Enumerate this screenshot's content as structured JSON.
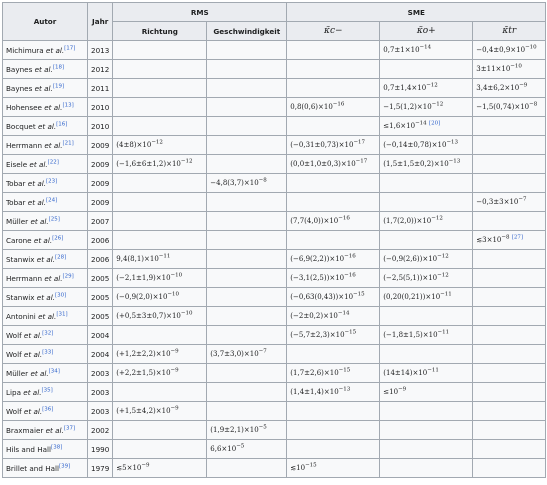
{
  "headers": {
    "autor": "Autor",
    "jahr": "Jahr",
    "rms": "RMS",
    "sme": "SME",
    "richtung": "Richtung",
    "geschwindigkeit": "Geschwindigkeit",
    "kappa_cminus": "κ̃c−",
    "kappa_oplus": "κ̃o+",
    "kappa_tr": "κ̃tr"
  },
  "rows": [
    {
      "author": "Michimura",
      "etal": true,
      "ref": "[17]",
      "year": "2013",
      "richtung": "",
      "geschw": "",
      "c": "",
      "o": "0,7±1×10",
      "o_exp": "−14",
      "o_ref": "",
      "tr": "−0,4±0,9×10",
      "tr_exp": "−10"
    },
    {
      "author": "Baynes",
      "etal": true,
      "ref": "[18]",
      "year": "2012",
      "richtung": "",
      "geschw": "",
      "c": "",
      "o": "",
      "tr": "3±11×10",
      "tr_exp": "−10"
    },
    {
      "author": "Baynes",
      "etal": true,
      "ref": "[19]",
      "year": "2011",
      "richtung": "",
      "geschw": "",
      "c": "",
      "o": "0,7±1,4×10",
      "o_exp": "−12",
      "tr": "3,4±6,2×10",
      "tr_exp": "−9"
    },
    {
      "author": "Hohensee",
      "etal": true,
      "ref": "[13]",
      "year": "2010",
      "richtung": "",
      "geschw": "",
      "c": "0,8(0,6)×10",
      "c_exp": "−16",
      "o": "−1,5(1,2)×10",
      "o_exp": "−12",
      "tr": "−1,5(0,74)×10",
      "tr_exp": "−8"
    },
    {
      "author": "Bocquet",
      "etal": true,
      "ref": "[16]",
      "year": "2010",
      "richtung": "",
      "geschw": "",
      "c": "",
      "o": "≤1,6×10",
      "o_exp": "−14",
      "o_ref": "[20]",
      "tr": ""
    },
    {
      "author": "Herrmann",
      "etal": true,
      "ref": "[21]",
      "year": "2009",
      "richtung": "(4±8)×10",
      "r_exp": "−12",
      "geschw": "",
      "c": "(−0,31±0,73)×10",
      "c_exp": "−17",
      "o": "(−0,14±0,78)×10",
      "o_exp": "−13",
      "tr": ""
    },
    {
      "author": "Eisele",
      "etal": true,
      "ref": "[22]",
      "year": "2009",
      "richtung": "(−1,6±6±1,2)×10",
      "r_exp": "−12",
      "geschw": "",
      "c": "(0,0±1,0±0,3)×10",
      "c_exp": "−17",
      "o": "(1,5±1,5±0,2)×10",
      "o_exp": "−13",
      "tr": ""
    },
    {
      "author": "Tobar",
      "etal": true,
      "ref": "[23]",
      "year": "2009",
      "richtung": "",
      "geschw": "−4,8(3,7)×10",
      "g_exp": "−8",
      "c": "",
      "o": "",
      "tr": ""
    },
    {
      "author": "Tobar",
      "etal": true,
      "ref": "[24]",
      "year": "2009",
      "richtung": "",
      "geschw": "",
      "c": "",
      "o": "",
      "tr": "−0,3±3×10",
      "tr_exp": "−7"
    },
    {
      "author": "Müller",
      "etal": true,
      "ref": "[25]",
      "year": "2007",
      "richtung": "",
      "geschw": "",
      "c": "(7,7(4,0))×10",
      "c_exp": "−16",
      "o": "(1,7(2,0))×10",
      "o_exp": "−12",
      "tr": ""
    },
    {
      "author": "Carone",
      "etal": true,
      "ref": "[26]",
      "year": "2006",
      "richtung": "",
      "geschw": "",
      "c": "",
      "o": "",
      "tr": "≲3×10",
      "tr_exp": "−8",
      "tr_ref": "[27]"
    },
    {
      "author": "Stanwix",
      "etal": true,
      "ref": "[28]",
      "year": "2006",
      "richtung": "9,4(8,1)×10",
      "r_exp": "−11",
      "geschw": "",
      "c": "(−6,9(2,2))×10",
      "c_exp": "−16",
      "o": "(−0,9(2,6))×10",
      "o_exp": "−12",
      "tr": ""
    },
    {
      "author": "Herrmann",
      "etal": true,
      "ref": "[29]",
      "year": "2005",
      "richtung": "(−2,1±1,9)×10",
      "r_exp": "−10",
      "geschw": "",
      "c": "(−3,1(2,5))×10",
      "c_exp": "−16",
      "o": "(−2,5(5,1))×10",
      "o_exp": "−12",
      "tr": ""
    },
    {
      "author": "Stanwix",
      "etal": true,
      "ref": "[30]",
      "year": "2005",
      "richtung": "(−0,9(2,0)×10",
      "r_exp": "−10",
      "geschw": "",
      "c": "(−0,63(0,43))×10",
      "c_exp": "−15",
      "o": "(0,20(0,21))×10",
      "o_exp": "−11",
      "tr": ""
    },
    {
      "author": "Antonini",
      "etal": true,
      "ref": "[31]",
      "year": "2005",
      "richtung": "(+0,5±3±0,7)×10",
      "r_exp": "−10",
      "geschw": "",
      "c": "(−2±0,2)×10",
      "c_exp": "−14",
      "o": "",
      "tr": ""
    },
    {
      "author": "Wolf",
      "etal": true,
      "ref": "[32]",
      "year": "2004",
      "richtung": "",
      "geschw": "",
      "c": "(−5,7±2,3)×10",
      "c_exp": "−15",
      "o": "(−1,8±1,5)×10",
      "o_exp": "−11",
      "tr": ""
    },
    {
      "author": "Wolf",
      "etal": true,
      "ref": "[33]",
      "year": "2004",
      "richtung": "(+1,2±2,2)×10",
      "r_exp": "−9",
      "geschw": "(3,7±3,0)×10",
      "g_exp": "−7",
      "c": "",
      "o": "",
      "tr": ""
    },
    {
      "author": "Müller",
      "etal": true,
      "ref": "[34]",
      "year": "2003",
      "richtung": "(+2,2±1,5)×10",
      "r_exp": "−9",
      "geschw": "",
      "c": "(1,7±2,6)×10",
      "c_exp": "−15",
      "o": "(14±14)×10",
      "o_exp": "−11",
      "tr": ""
    },
    {
      "author": "Lipa",
      "etal": true,
      "ref": "[35]",
      "year": "2003",
      "richtung": "",
      "geschw": "",
      "c": "(1,4±1,4)×10",
      "c_exp": "−13",
      "o": "≤10",
      "o_exp": "−9",
      "tr": ""
    },
    {
      "author": "Wolf",
      "etal": true,
      "ref": "[36]",
      "year": "2003",
      "richtung": "(+1,5±4,2)×10",
      "r_exp": "−9",
      "geschw": "",
      "c": "",
      "o": "",
      "tr": ""
    },
    {
      "author": "Braxmaier",
      "etal": true,
      "ref": "[37]",
      "year": "2002",
      "richtung": "",
      "geschw": "(1,9±2,1)×10",
      "g_exp": "−5",
      "c": "",
      "o": "",
      "tr": ""
    },
    {
      "author": "Hils and Hall",
      "etal": false,
      "ref": "[38]",
      "year": "1990",
      "richtung": "",
      "geschw": "6,6×10",
      "g_exp": "−5",
      "c": "",
      "o": "",
      "tr": ""
    },
    {
      "author": "Brillet and Hall",
      "etal": false,
      "ref": "[39]",
      "year": "1979",
      "richtung": "≲5×10",
      "r_exp": "−9",
      "geschw": "",
      "c": "≲10",
      "c_exp": "−15",
      "o": "",
      "tr": ""
    }
  ]
}
